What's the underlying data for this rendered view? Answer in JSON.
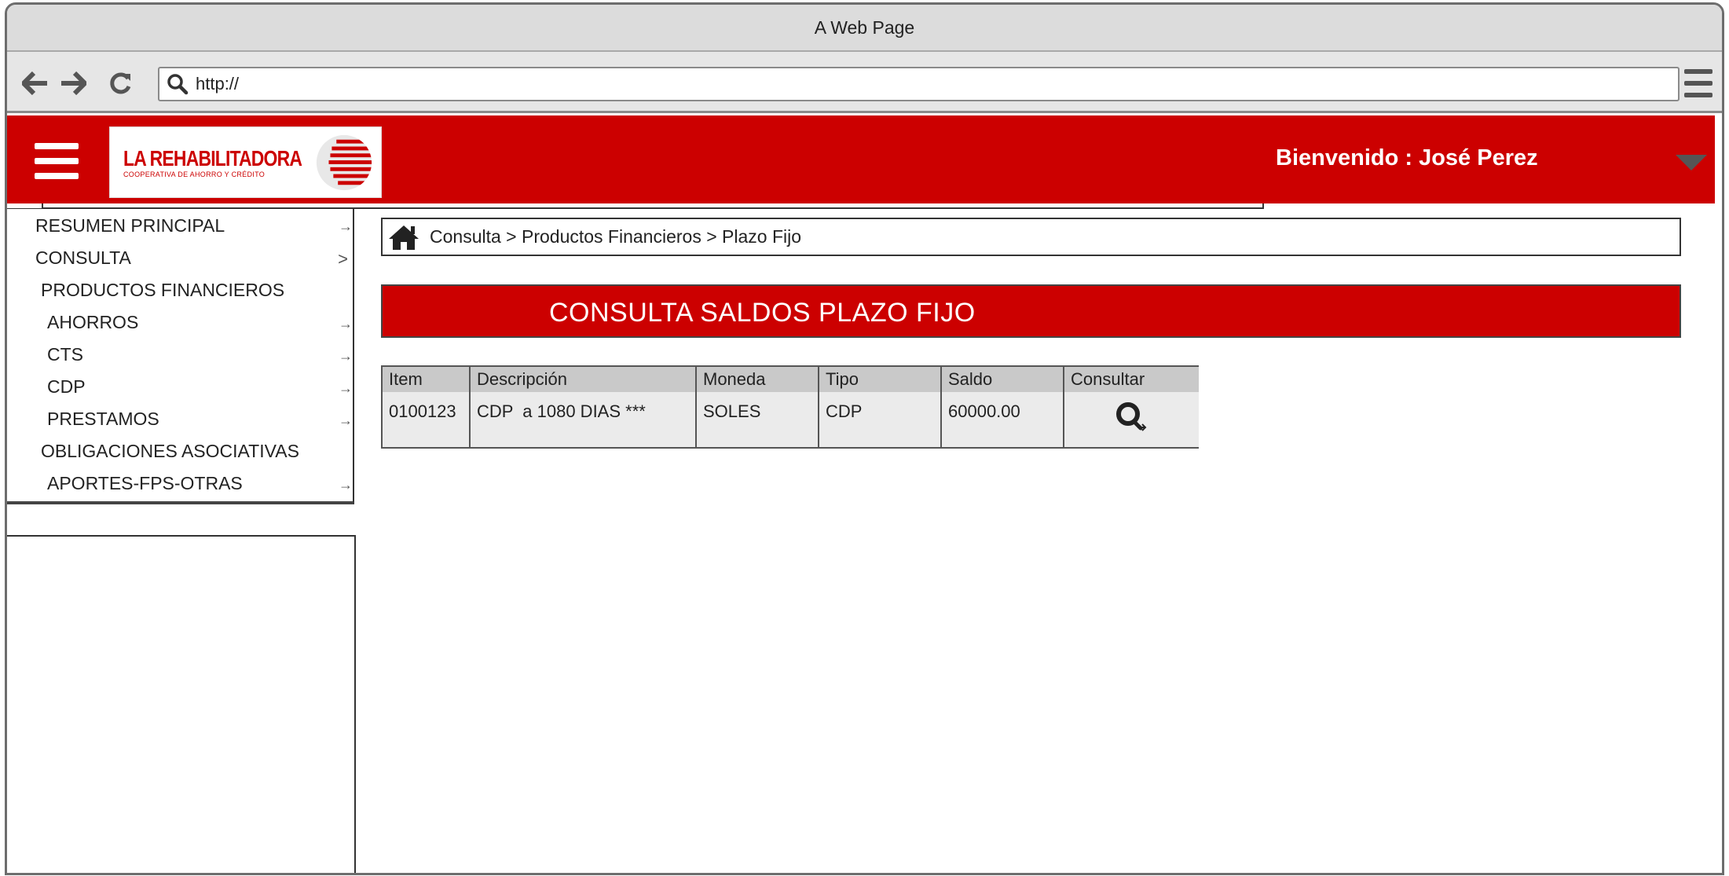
{
  "window": {
    "title": "A Web Page"
  },
  "browser": {
    "url": "http://",
    "icons": {
      "back": "arrow-left-icon",
      "forward": "arrow-right-icon",
      "reload": "reload-icon",
      "search": "search-icon",
      "menu": "hamburger-menu-icon"
    }
  },
  "header": {
    "brand_name": "LA REHABILITADORA",
    "brand_subtitle": "COOPERATIVA DE AHORRO Y CRÉDITO",
    "welcome_text": "Bienvenido : José Perez",
    "accent_color": "#cc0000"
  },
  "sidebar": {
    "items": [
      {
        "label": "RESUMEN PRINCIPAL",
        "marker": "→"
      },
      {
        "label": "CONSULTA",
        "marker": ">"
      },
      {
        "label": "PRODUCTOS FINANCIEROS",
        "marker": ""
      },
      {
        "label": "AHORROS",
        "marker": "→"
      },
      {
        "label": "CTS",
        "marker": "→"
      },
      {
        "label": "CDP",
        "marker": "→"
      },
      {
        "label": "PRESTAMOS",
        "marker": "→"
      },
      {
        "label": "OBLIGACIONES ASOCIATIVAS",
        "marker": ""
      },
      {
        "label": "APORTES-FPS-OTRAS",
        "marker": "→"
      }
    ]
  },
  "breadcrumb": {
    "text": "Consulta > Productos Financieros > Plazo Fijo",
    "icon": "home-icon"
  },
  "section": {
    "title": "CONSULTA SALDOS PLAZO FIJO"
  },
  "table": {
    "columns": [
      "Item",
      "Descripción",
      "Moneda",
      "Tipo",
      "Saldo",
      "Consultar"
    ],
    "rows": [
      {
        "item": "0100123",
        "descripcion": "CDP  a 1080 DIAS ***",
        "moneda": "SOLES",
        "tipo": "CDP",
        "saldo": "60000.00",
        "consultar_icon": "magnifier-icon"
      }
    ]
  }
}
